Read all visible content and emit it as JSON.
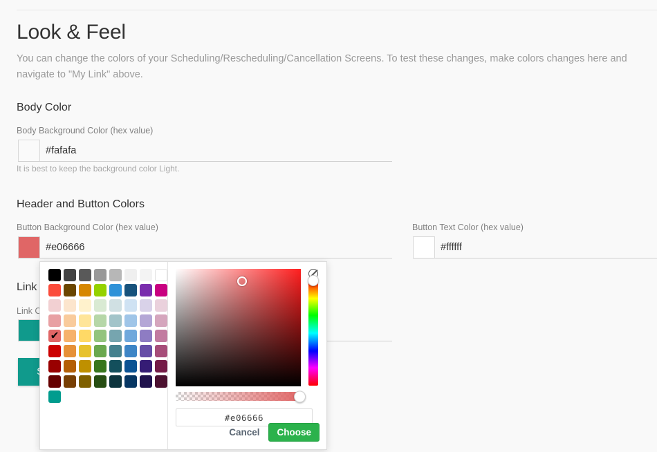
{
  "page": {
    "title": "Look & Feel",
    "description": "You can change the colors of your Scheduling/Rescheduling/Cancellation Screens. To test these changes, make colors changes here and\nnavigate to \"My Link\" above."
  },
  "sections": {
    "body_color": {
      "heading": "Body Color",
      "field_label": "Body Background Color (hex value)",
      "value": "#fafafa",
      "swatch_color": "#fafafa",
      "help": "It is best to keep the background color Light."
    },
    "header_button_colors": {
      "heading": "Header and Button Colors",
      "button_background": {
        "field_label": "Button Background Color (hex value)",
        "value": "#e06666",
        "swatch_color": "#e06666"
      },
      "button_text": {
        "field_label": "Button Text Color (hex value)",
        "value": "#ffffff",
        "swatch_color": "#ffffff"
      }
    },
    "link": {
      "heading": "Link",
      "field_label": "Link C",
      "swatch_color": "#109a8c"
    }
  },
  "save_button": {
    "label": "SAVE"
  },
  "color_picker": {
    "selected_hex": "#e06666",
    "hex_field_value": "#e06666",
    "no_color_icon": "no-color-icon",
    "actions": {
      "cancel": "Cancel",
      "choose": "Choose"
    },
    "palette_rows": [
      [
        "#000000",
        "#434343",
        "#595959",
        "#999999",
        "#b7b7b7",
        "#efefef",
        "#f3f3f3",
        "#ffffff"
      ],
      [
        "#fb4c3b",
        "#6b4600",
        "#d68700",
        "#95d200",
        "#2f92d8",
        "#17527c",
        "#7a2dad",
        "#c80080"
      ],
      [
        "#f2d0d2",
        "#fce5cd",
        "#fff2cc",
        "#d9ead3",
        "#d0e0e3",
        "#cfe2f3",
        "#d9d2e9",
        "#ead1dc"
      ],
      [
        "#e8a0a3",
        "#f9cb9c",
        "#ffe599",
        "#b6d7a8",
        "#a2c4c9",
        "#9fc5e8",
        "#b4a7d6",
        "#d5a6bd"
      ],
      [
        "#e06666",
        "#f6b26b",
        "#ffd966",
        "#93c47d",
        "#76a5af",
        "#6fa8dc",
        "#8e7cc3",
        "#c27ba0"
      ],
      [
        "#cc0000",
        "#e69138",
        "#e7c22e",
        "#6aa84f",
        "#45818e",
        "#3d85c6",
        "#674ea7",
        "#a64d79"
      ],
      [
        "#990000",
        "#b45f06",
        "#bf9000",
        "#38761d",
        "#134f5c",
        "#0b5394",
        "#351c75",
        "#741b47"
      ],
      [
        "#660000",
        "#783f04",
        "#7f6000",
        "#274e13",
        "#0c343d",
        "#073763",
        "#20124d",
        "#4c1130"
      ]
    ],
    "custom_swatches": [
      "#009c8e"
    ]
  }
}
